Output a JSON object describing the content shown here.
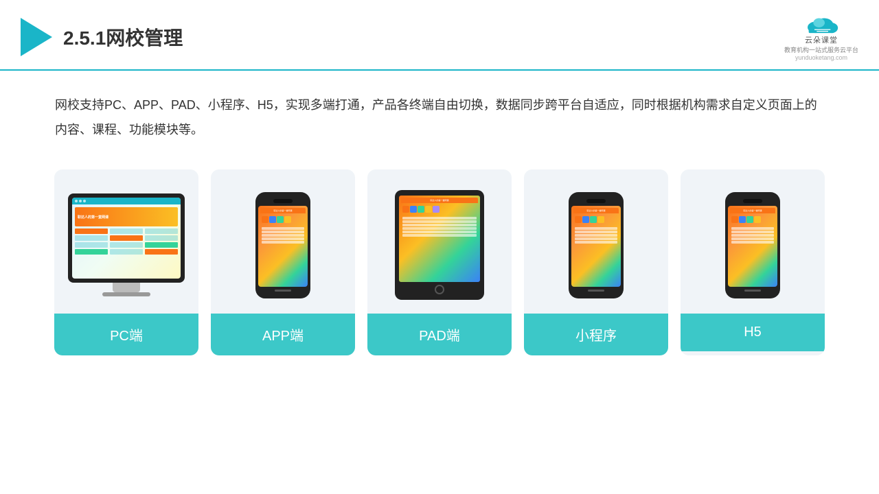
{
  "header": {
    "title": "2.5.1网校管理",
    "brand": {
      "name": "云朵课堂",
      "url": "yunduoketang.com",
      "tagline": "教育机构一站式服务云平台"
    }
  },
  "description": {
    "text": "网校支持PC、APP、PAD、小程序、H5，实现多端打通，产品各终端自由切换，数据同步跨平台自适应，同时根据机构需求自定义页面上的内容、课程、功能模块等。"
  },
  "cards": [
    {
      "id": "pc",
      "label": "PC端",
      "device": "pc"
    },
    {
      "id": "app",
      "label": "APP端",
      "device": "phone"
    },
    {
      "id": "pad",
      "label": "PAD端",
      "device": "tablet"
    },
    {
      "id": "mini",
      "label": "小程序",
      "device": "phone"
    },
    {
      "id": "h5",
      "label": "H5",
      "device": "phone"
    }
  ],
  "colors": {
    "teal": "#3cc8c8",
    "border": "#1ab5c8",
    "bg_card": "#f0f4f8",
    "text_dark": "#333333"
  }
}
